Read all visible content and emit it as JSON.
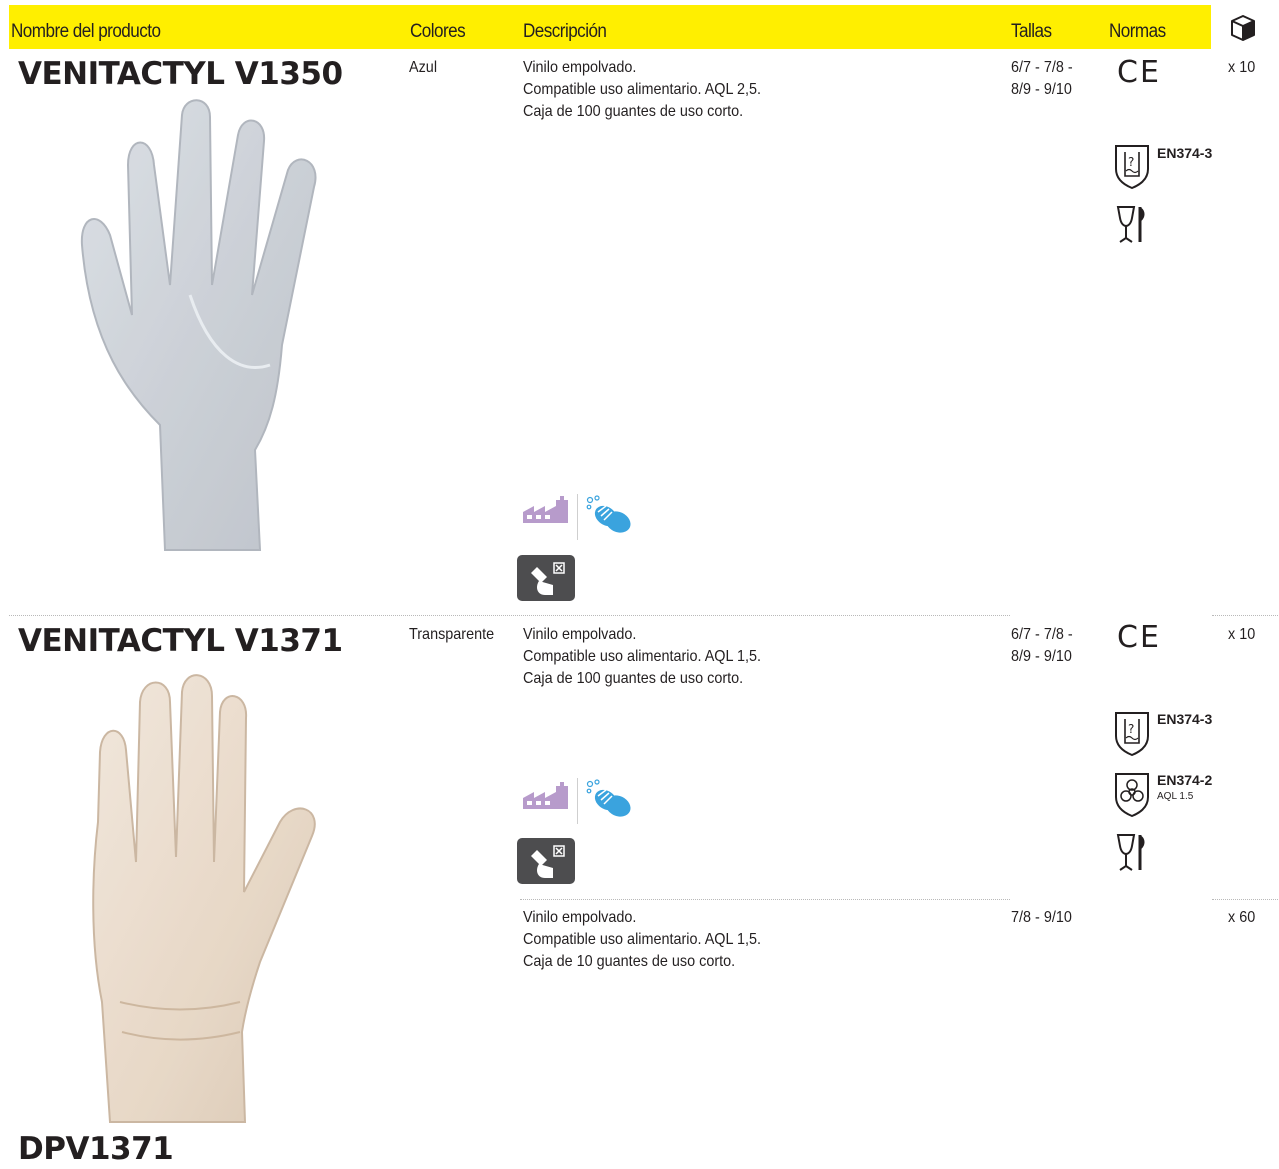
{
  "header": {
    "col_name": "Nombre del producto",
    "col_colors": "Colores",
    "col_description": "Descripción",
    "col_sizes": "Tallas",
    "col_norms": "Normas",
    "col_box_icon": "box-icon"
  },
  "products": [
    {
      "name": "VENITACTYL V1350",
      "color": "Azul",
      "description": [
        "Vinilo empolvado.",
        "Compatible uso alimentario. AQL 2,5.",
        "Caja de 100 guantes de uso corto."
      ],
      "sizes": [
        "6/7 - 7/8 -",
        "8/9 - 9/10"
      ],
      "norms": [
        {
          "icon": "ce-mark",
          "label": "CE"
        },
        {
          "icon": "chemical-shield-icon",
          "label": "EN374-3"
        },
        {
          "icon": "food-contact-icon",
          "label": ""
        }
      ],
      "pack": "x 10"
    },
    {
      "name": "VENITACTYL V1371",
      "color": "Transparente",
      "description": [
        "Vinilo empolvado.",
        "Compatible uso alimentario. AQL 1,5.",
        "Caja de 100 guantes de uso corto."
      ],
      "sizes": [
        "6/7 - 7/8 -",
        "8/9 - 9/10"
      ],
      "norms": [
        {
          "icon": "ce-mark",
          "label": "CE"
        },
        {
          "icon": "chemical-shield-icon",
          "label": "EN374-3"
        },
        {
          "icon": "biohazard-shield-icon",
          "label": "EN374-2",
          "sub": "AQL 1.5"
        },
        {
          "icon": "food-contact-icon",
          "label": ""
        }
      ],
      "pack": "x 10"
    },
    {
      "name": "DPV1371",
      "color": "",
      "description": [
        "Vinilo empolvado.",
        "Compatible uso alimentario. AQL 1,5.",
        "Caja de 10 guantes de uso corto."
      ],
      "sizes": [
        "7/8 - 9/10"
      ],
      "norms": [],
      "pack": "x 60"
    }
  ],
  "usage_icons": [
    "factory-icon",
    "hand-washing-icon",
    "no-cut-protection-icon"
  ],
  "colors": {
    "header_bg": "#ffef00",
    "text": "#231f20",
    "usage_purple": "#b79bcb",
    "usage_blue": "#3aa3de",
    "hazard_bg": "#4d4d4f"
  }
}
